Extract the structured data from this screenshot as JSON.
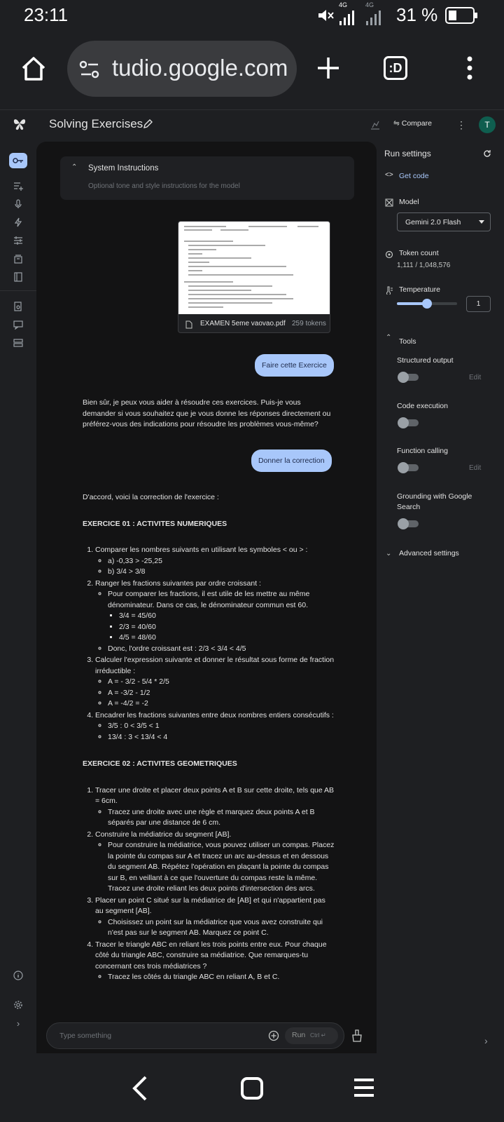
{
  "status_bar": {
    "time": "23:11",
    "net_top": "4G",
    "net_top2": "4G",
    "battery": "31 %"
  },
  "browser": {
    "url": "tudio.google.com",
    "tabs_icon_label": ":D"
  },
  "header": {
    "title": "Solving Exercises",
    "compare_label": "Compare",
    "avatar_initial": "T"
  },
  "system_instructions": {
    "title": "System Instructions",
    "placeholder": "Optional tone and style instructions for the model"
  },
  "attachment": {
    "filename": "EXAMEN 5eme vaovao.pdf",
    "tokens": "259 tokens"
  },
  "messages": {
    "user1": "Faire cette Exercice",
    "model1": "Bien sûr, je peux vous aider à résoudre ces exercices. Puis-je vous demander si vous souhaitez que je vous donne les réponses directement ou préférez-vous des indications pour résoudre les problèmes vous-même?",
    "user2": "Donner la correction",
    "model2_intro": "D'accord, voici la correction de l'exercice :",
    "ex1_title": "EXERCICE 01 : ACTIVITES NUMERIQUES",
    "ex1": {
      "i1": "Comparer les nombres suivants en utilisant les symboles < ou > :",
      "i1a": "a) -0,33 > -25,25",
      "i1b": "b) 3/4 > 3/8",
      "i2": "Ranger les fractions suivantes par ordre croissant :",
      "i2a": "Pour comparer les fractions, il est utile de les mettre au même dénominateur. Dans ce cas, le dénominateur commun est 60.",
      "i2a1": "3/4 = 45/60",
      "i2a2": "2/3 = 40/60",
      "i2a3": "4/5 = 48/60",
      "i2b": "Donc, l'ordre croissant est : 2/3 < 3/4 < 4/5",
      "i3": "Calculer l'expression suivante et donner le résultat sous forme de fraction irréductible :",
      "i3a": "A = - 3/2 - 5/4 * 2/5",
      "i3b": "A = -3/2 - 1/2",
      "i3c": "A = -4/2 = -2",
      "i4": "Encadrer les fractions suivantes entre deux nombres entiers consécutifs :",
      "i4a": "3/5 : 0 < 3/5 < 1",
      "i4b": "13/4 : 3 < 13/4 < 4"
    },
    "ex2_title": "EXERCICE 02 : ACTIVITES GEOMETRIQUES",
    "ex2": {
      "i1": "Tracer une droite et placer deux points A et B sur cette droite, tels que AB = 6cm.",
      "i1a": "Tracez une droite avec une règle et marquez deux points A et B séparés par une distance de 6 cm.",
      "i2": "Construire la médiatrice du segment [AB].",
      "i2a": "Pour construire la médiatrice, vous pouvez utiliser un compas. Placez la pointe du compas sur A et tracez un arc au-dessus et en dessous du segment AB. Répétez l'opération en plaçant la pointe du compas sur B, en veillant à ce que l'ouverture du compas reste la même. Tracez une droite reliant les deux points d'intersection des arcs.",
      "i3": "Placer un point C situé sur la médiatrice de [AB] et qui n'appartient pas au segment [AB].",
      "i3a": "Choisissez un point sur la médiatrice que vous avez construite qui n'est pas sur le segment AB. Marquez ce point C.",
      "i4": "Tracer le triangle ABC en reliant les trois points entre eux. Pour chaque côté du triangle ABC, construire sa médiatrice. Que remarques-tu concernant ces trois médiatrices ?",
      "i4a": "Tracez les côtés du triangle ABC en reliant A, B et C."
    }
  },
  "input": {
    "placeholder": "Type something",
    "run_label": "Run",
    "run_shortcut": "Ctrl ↵"
  },
  "run_settings": {
    "title": "Run settings",
    "get_code": "Get code",
    "model_label": "Model",
    "model_value": "Gemini 2.0 Flash",
    "token_label": "Token count",
    "token_value": "1,111 / 1,048,576",
    "temperature_label": "Temperature",
    "temperature_value": "1",
    "temperature_fraction": 0.5,
    "tools_label": "Tools",
    "structured_output": "Structured output",
    "code_execution": "Code execution",
    "function_calling": "Function calling",
    "grounding": "Grounding with Google Search",
    "edit": "Edit",
    "advanced": "Advanced settings"
  },
  "colors": {
    "accent": "#a8c7fa",
    "avatar": "#0f5e4f",
    "background": "#1e1f22",
    "panel": "#131314"
  }
}
